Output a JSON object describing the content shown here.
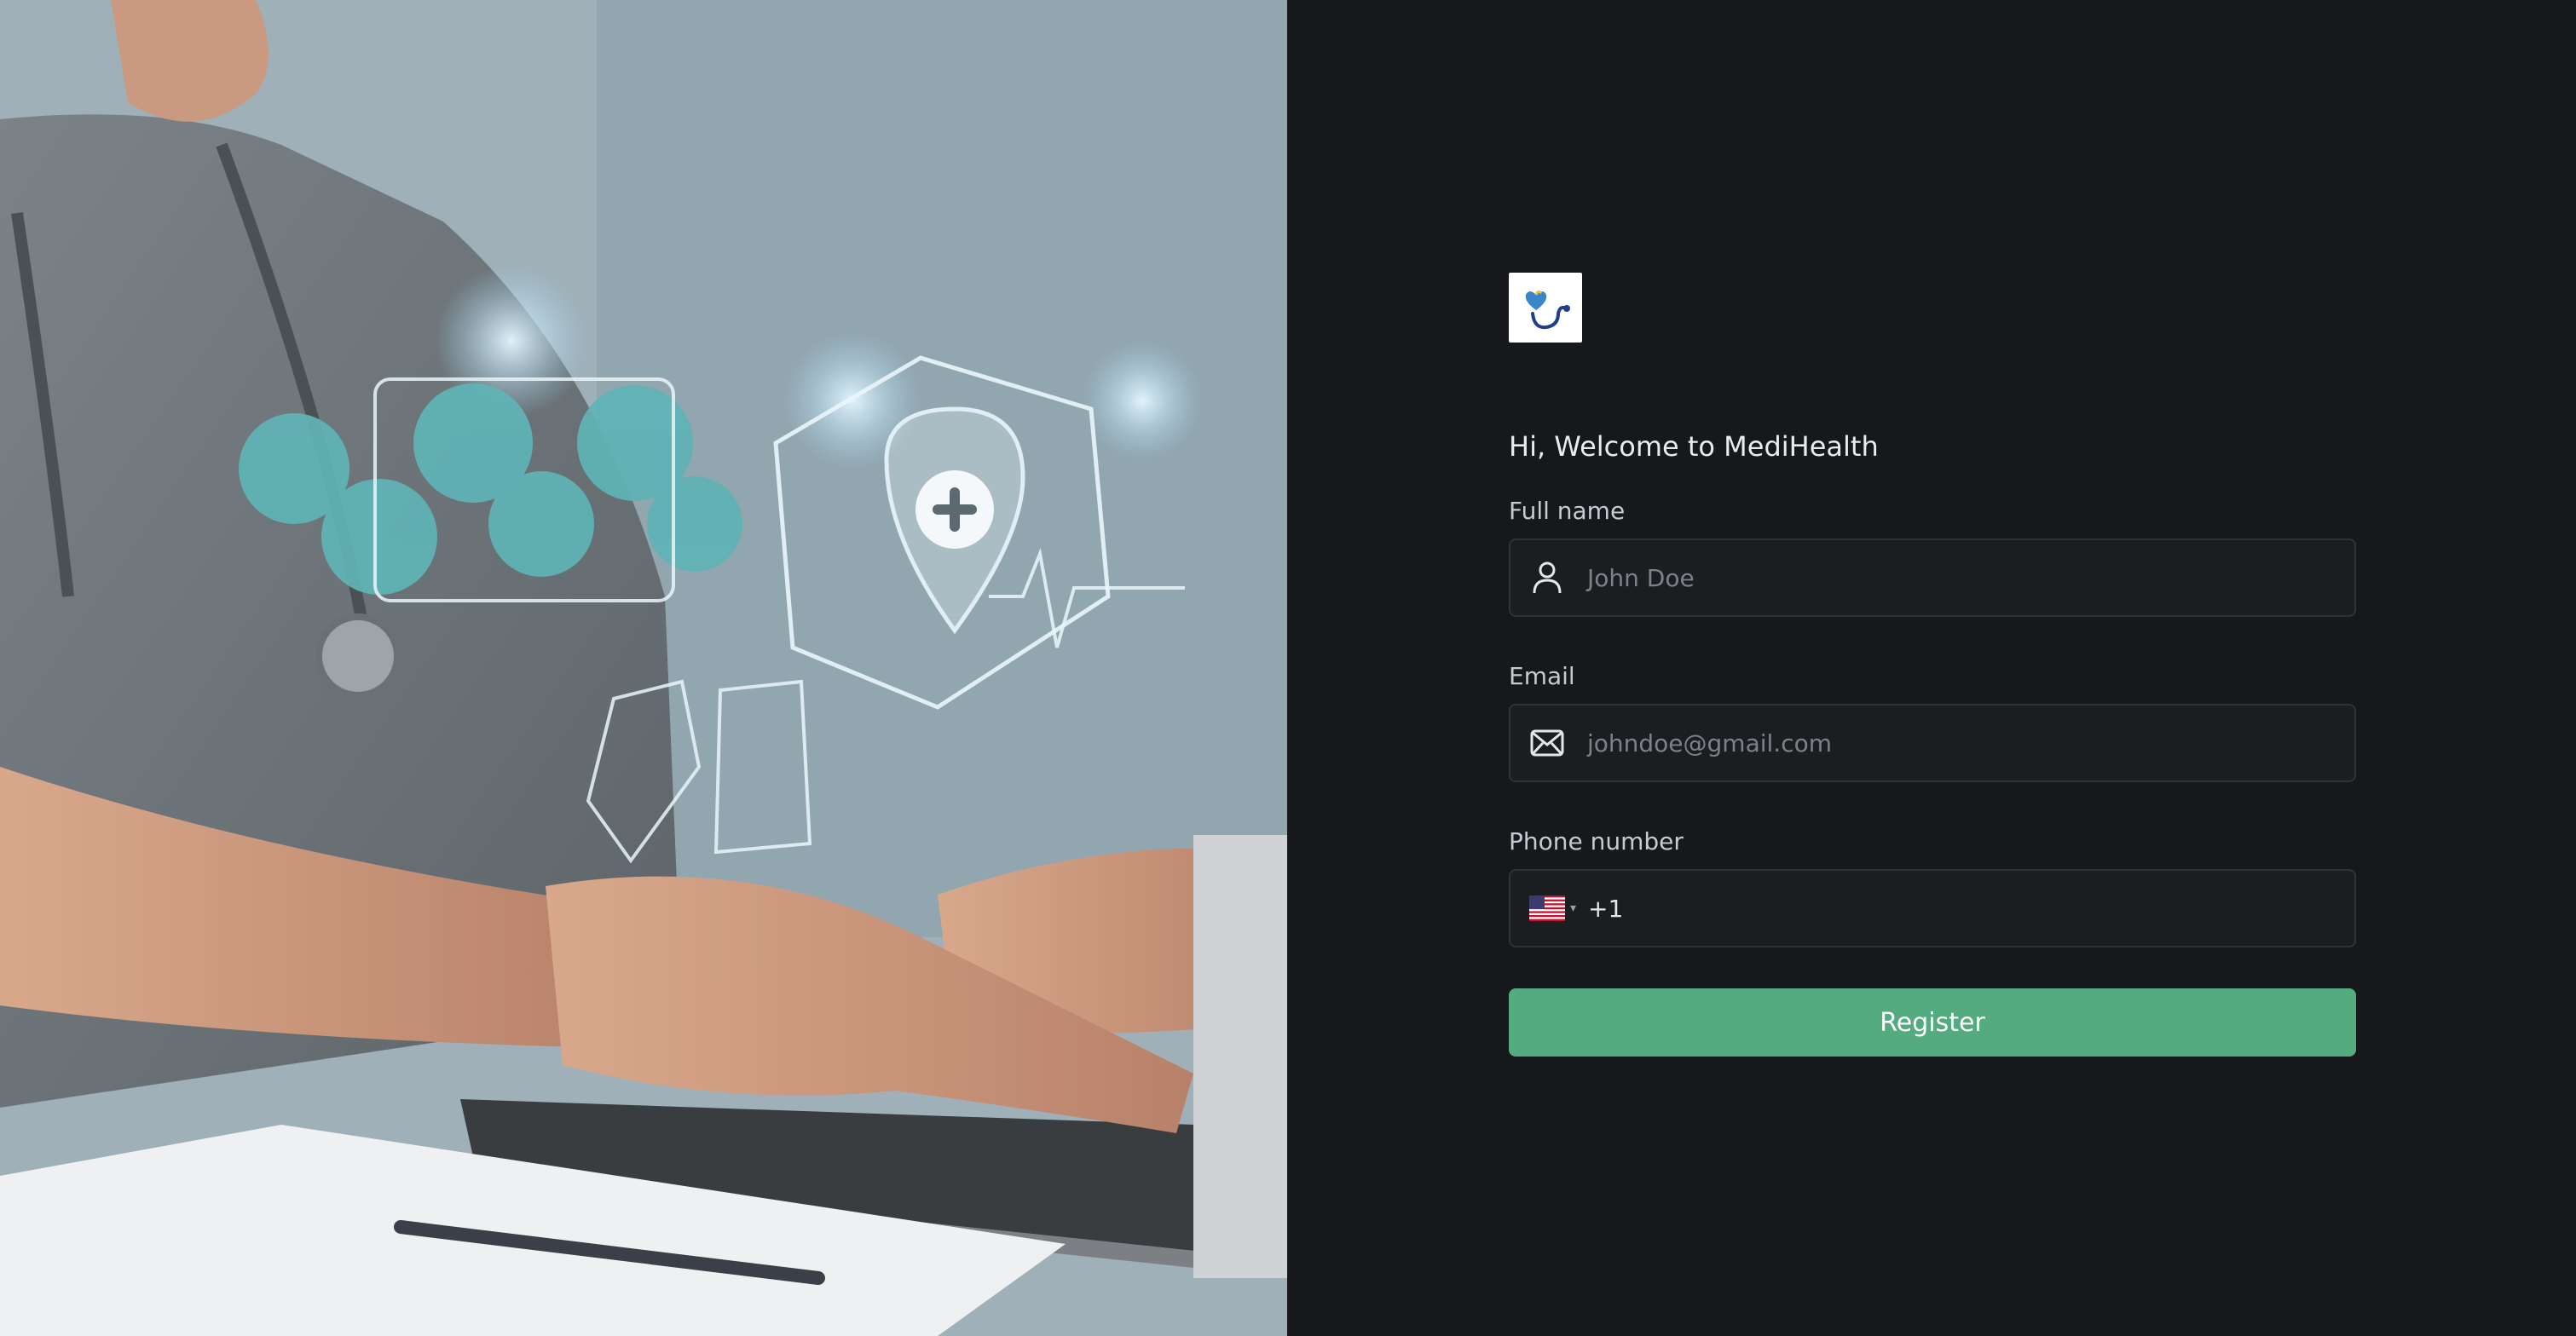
{
  "form": {
    "welcome": "Hi, Welcome to MediHealth",
    "full_name_label": "Full name",
    "full_name_placeholder": "John Doe",
    "email_label": "Email",
    "email_placeholder": "johndoe@gmail.com",
    "phone_label": "Phone number",
    "phone_country_code": "+1",
    "register_label": "Register"
  },
  "colors": {
    "background": "#17181c",
    "accent": "#53ab7f",
    "input_border": "#2f3238"
  },
  "icons": {
    "full_name": "user-icon",
    "email": "mail-icon",
    "phone_flag": "us-flag-icon",
    "logo": "stethoscope-heart-logo"
  }
}
